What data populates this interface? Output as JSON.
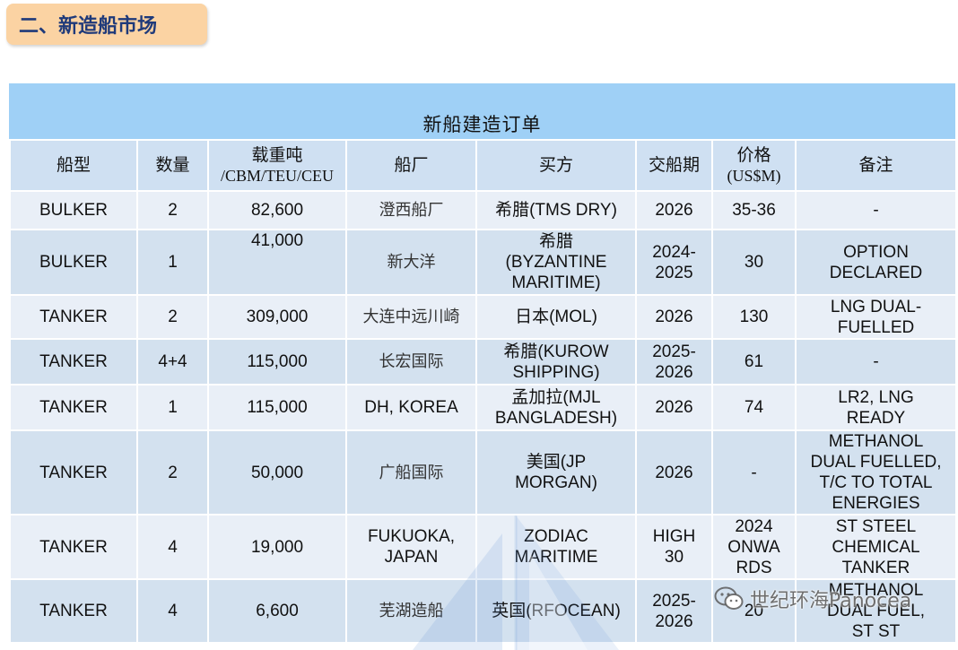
{
  "section_title": "二、新造船市场",
  "table": {
    "title": "新船建造订单",
    "headers": {
      "ship_type": "船型",
      "quantity": "数量",
      "dwt_line1": "载重吨",
      "dwt_line2": "/CBM/TEU/CEU",
      "shipyard": "船厂",
      "buyer": "买方",
      "delivery": "交船期",
      "price_line1": "价格",
      "price_line2": "(US$M)",
      "remarks": "备注"
    },
    "rows": [
      {
        "type": "BULKER",
        "qty": "2",
        "dwt": "82,600",
        "yard": "澄西船厂",
        "buyer": "希腊(TMS DRY)",
        "delivery": "2026",
        "price": "35-36",
        "remark": "-"
      },
      {
        "type": "BULKER",
        "qty": "1",
        "dwt": "41,000",
        "yard": "新大洋",
        "buyer": "希腊\n(BYZANTINE\nMARITIME)",
        "delivery": "2024-\n2025",
        "price": "30",
        "remark": "OPTION\nDECLARED"
      },
      {
        "type": "TANKER",
        "qty": "2",
        "dwt": "309,000",
        "yard": "大连中远川崎",
        "buyer": "日本(MOL)",
        "delivery": "2026",
        "price": "130",
        "remark": "LNG DUAL-\nFUELLED"
      },
      {
        "type": "TANKER",
        "qty": "4+4",
        "dwt": "115,000",
        "yard": "长宏国际",
        "buyer": "希腊(KUROW\nSHIPPING)",
        "delivery": "2025-\n2026",
        "price": "61",
        "remark": "-"
      },
      {
        "type": "TANKER",
        "qty": "1",
        "dwt": "115,000",
        "yard": "DH, KOREA",
        "buyer": "孟加拉(MJL\nBANGLADESH)",
        "delivery": "2026",
        "price": "74",
        "remark": "LR2, LNG\nREADY"
      },
      {
        "type": "TANKER",
        "qty": "2",
        "dwt": "50,000",
        "yard": "广船国际",
        "buyer": "美国(JP\nMORGAN)",
        "delivery": "2026",
        "price": "-",
        "remark": "METHANOL\nDUAL FUELLED,\nT/C TO TOTAL\nENERGIES"
      },
      {
        "type": "TANKER",
        "qty": "4",
        "dwt": "19,000",
        "yard": "FUKUOKA,\nJAPAN",
        "buyer": "ZODIAC\nMARITIME",
        "delivery": "HIGH\n30",
        "price": "2024\nONWA\nRDS",
        "remark": "ST STEEL\nCHEMICAL\nTANKER"
      },
      {
        "type": "TANKER",
        "qty": "4",
        "dwt": "6,600",
        "yard": "芜湖造船",
        "buyer": "英国(RFOCEAN)",
        "delivery": "2025-\n2026",
        "price": "20",
        "remark": "METHANOL\nDUAL FUEL,\nST ST"
      }
    ]
  },
  "watermark": {
    "text": "世纪环海Panocea"
  }
}
